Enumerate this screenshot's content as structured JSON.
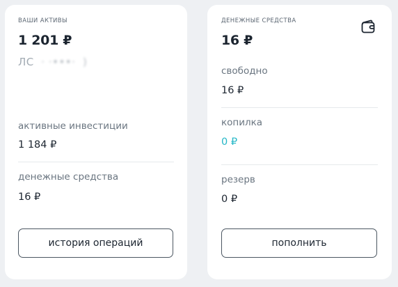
{
  "assets": {
    "caption": "ВАШИ АКТИВЫ",
    "total": "1 201 ₽",
    "account_prefix": "ЛС",
    "active_investments_label": "активные инвестиции",
    "active_investments_value": "1 184 ₽",
    "cash_label": "денежные средства",
    "cash_value": "16 ₽",
    "history_button": "история операций"
  },
  "cash": {
    "caption": "ДЕНЕЖНЫЕ СРЕДСТВА",
    "total": "16 ₽",
    "icon": "wallet-icon",
    "free_label": "свободно",
    "free_value": "16 ₽",
    "piggy_label": "копилка",
    "piggy_value": "0 ₽",
    "reserve_label": "резерв",
    "reserve_value": "0 ₽",
    "top_up_button": "пополнить"
  },
  "colors": {
    "background": "#eef0f3",
    "card": "#ffffff",
    "text": "#1c2530",
    "muted": "#6a7580",
    "accent_teal": "#25b7c7"
  }
}
